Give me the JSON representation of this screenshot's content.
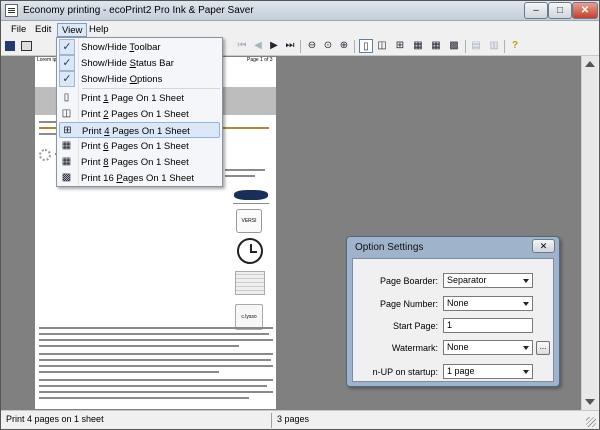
{
  "window": {
    "title": "Economy printing - ecoPrint2 Pro Ink & Paper Saver",
    "minimize_glyph": "–",
    "maximize_glyph": "□",
    "close_glyph": "✕"
  },
  "menubar": {
    "file": "File",
    "edit": "Edit",
    "view": "View",
    "help": "Help"
  },
  "toolbar": {
    "icons": [
      "save-icon",
      "print-icon",
      "first-page-icon",
      "prev-page-icon",
      "next-page-icon",
      "last-page-icon",
      "zoom-out-icon",
      "zoom-normal-icon",
      "zoom-in-icon",
      "one-page-icon",
      "two-pages-icon",
      "four-pages-icon",
      "six-pages-icon",
      "eight-pages-icon",
      "sixteen-pages-icon",
      "options-icon",
      "watermark-icon",
      "help-icon"
    ]
  },
  "view_menu": {
    "items": [
      {
        "pre": "Show/Hide ",
        "u": "T",
        "post": "oolbar",
        "checked": true
      },
      {
        "pre": "Show/Hide ",
        "u": "S",
        "post": "tatus Bar",
        "checked": true
      },
      {
        "pre": "Show/Hide ",
        "u": "O",
        "post": "ptions",
        "checked": true
      },
      {
        "pre": "Print ",
        "u": "1",
        "post": " Page  On 1 Sheet",
        "icon": "one-page-icon",
        "glyph": "▯"
      },
      {
        "pre": "Print ",
        "u": "2",
        "post": " Pages On 1 Sheet",
        "icon": "two-pages-icon",
        "glyph": "◫"
      },
      {
        "pre": "Print ",
        "u": "4",
        "post": " Pages On 1 Sheet",
        "icon": "four-pages-icon",
        "glyph": "⊞",
        "highlighted": true
      },
      {
        "pre": "Print ",
        "u": "6",
        "post": " Pages On 1 Sheet",
        "icon": "six-pages-icon",
        "glyph": "▦"
      },
      {
        "pre": "Print ",
        "u": "8",
        "post": " Pages On 1 Sheet",
        "icon": "eight-pages-icon",
        "glyph": "▦"
      },
      {
        "pre": "Print 16 ",
        "u": "P",
        "post": "ages On 1 Sheet",
        "icon": "sixteen-pages-icon",
        "glyph": "▩"
      }
    ]
  },
  "preview": {
    "page_label_left": "Lorem ips",
    "page_label_right": "Page 1 of 3",
    "graphic_texts": {
      "stamp": "VERSI",
      "mug": "c.lysso"
    }
  },
  "options_dialog": {
    "title": "Option Settings",
    "close_glyph": "✕",
    "page_boarder_label": "Page Boarder:",
    "page_boarder_value": "Separator",
    "page_number_label": "Page Number:",
    "page_number_value": "None",
    "start_page_label": "Start Page:",
    "start_page_value": "1",
    "watermark_label": "Watermark:",
    "watermark_value": "None",
    "browse_label": "...",
    "nup_label": "n-UP on startup:",
    "nup_value": "1 page"
  },
  "statusbar": {
    "left": "Print 4 pages on 1 sheet",
    "right": "3 pages"
  },
  "colors": {
    "background": "#808080",
    "dialog_frame": "#9fb3cb",
    "menu_highlight": "#dbe8f7"
  }
}
